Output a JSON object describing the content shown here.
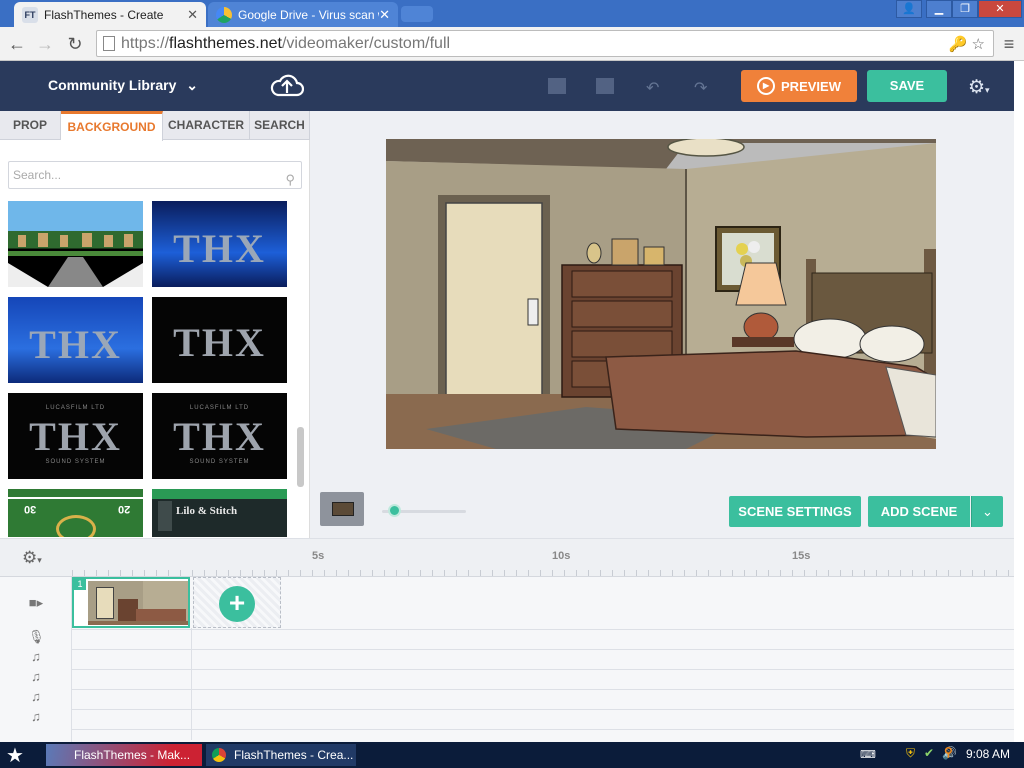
{
  "browser": {
    "tabs": [
      {
        "label": "FlashThemes - Create",
        "active": true
      },
      {
        "label": "Google Drive - Virus scan wa",
        "active": false
      }
    ],
    "url_scheme": "https://",
    "url_host": "flashthemes.net",
    "url_path": "/videomaker/custom/full"
  },
  "app": {
    "library_title": "Community Library",
    "panel_tabs": [
      "PROP",
      "BACKGROUND",
      "CHARACTER",
      "SEARCH"
    ],
    "active_tab": "BACKGROUND",
    "search_placeholder": "Search...",
    "preview_label": "PREVIEW",
    "save_label": "SAVE",
    "scene_settings_label": "SCENE SETTINGS",
    "add_scene_label": "ADD SCENE",
    "accent_color": "#3bbf9e",
    "preview_color": "#f0813a"
  },
  "backgrounds": [
    {
      "name": "South Park street"
    },
    {
      "name": "THX logo blue"
    },
    {
      "name": "THX logo blue 2"
    },
    {
      "name": "THX logo dark"
    },
    {
      "name": "THX Lucasfilm sound system"
    },
    {
      "name": "THX Lucasfilm sound system 2"
    },
    {
      "name": "Football field"
    },
    {
      "name": "Lilo & Stitch"
    }
  ],
  "thumb_text": {
    "thx": "THX",
    "lucasfilm": "LUCASFILM LTD",
    "sound_system": "SOUND SYSTEM",
    "field_left": "30",
    "field_right": "20",
    "stitch": "Lilo & Stitch"
  },
  "timeline": {
    "ticks": [
      "5s",
      "10s",
      "15s"
    ],
    "scene_number": "1"
  },
  "taskbar": {
    "items": [
      "FlashThemes - Mak...",
      "FlashThemes - Crea..."
    ],
    "clock": "9:08 AM"
  }
}
